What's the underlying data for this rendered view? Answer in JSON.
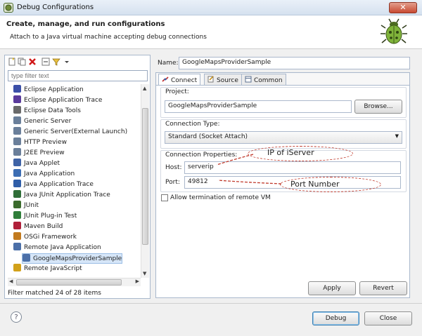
{
  "window": {
    "title": "Debug Configurations",
    "close_glyph": "✕"
  },
  "header": {
    "title": "Create, manage, and run configurations",
    "subtitle": "Attach to a Java virtual machine accepting debug connections"
  },
  "left": {
    "filter_placeholder": "type filter text",
    "filter_status": "Filter matched 24 of 28 items",
    "tree": [
      {
        "label": "Eclipse Application",
        "icon": "eclipse-app-icon",
        "color": "#3b4fa8",
        "indent": 0
      },
      {
        "label": "Eclipse Application Trace",
        "icon": "eclipse-trace-icon",
        "color": "#5a3a9c",
        "indent": 0
      },
      {
        "label": "Eclipse Data Tools",
        "icon": "data-tools-icon",
        "color": "#6a6a6a",
        "indent": 0
      },
      {
        "label": "Generic Server",
        "icon": "server-icon",
        "color": "#6a7f9a",
        "indent": 0
      },
      {
        "label": "Generic Server(External Launch)",
        "icon": "server-icon",
        "color": "#6a7f9a",
        "indent": 0
      },
      {
        "label": "HTTP Preview",
        "icon": "server-icon",
        "color": "#6a7f9a",
        "indent": 0
      },
      {
        "label": "J2EE Preview",
        "icon": "server-icon",
        "color": "#6a7f9a",
        "indent": 0
      },
      {
        "label": "Java Applet",
        "icon": "applet-icon",
        "color": "#3f63a6",
        "indent": 0
      },
      {
        "label": "Java Application",
        "icon": "java-app-icon",
        "color": "#3c6db3",
        "indent": 0
      },
      {
        "label": "Java Application Trace",
        "icon": "java-trace-icon",
        "color": "#2f5ea8",
        "indent": 0
      },
      {
        "label": "Java JUnit Application Trace",
        "icon": "junit-trace-icon",
        "color": "#2f6e38",
        "indent": 0
      },
      {
        "label": "JUnit",
        "icon": "junit-icon",
        "color": "#3b6b2c",
        "indent": 0
      },
      {
        "label": "JUnit Plug-in Test",
        "icon": "junit-plugin-icon",
        "color": "#2f7e3a",
        "indent": 0
      },
      {
        "label": "Maven Build",
        "icon": "maven-icon",
        "color": "#b0203a",
        "indent": 0
      },
      {
        "label": "OSGi Framework",
        "icon": "osgi-icon",
        "color": "#c27a1e",
        "indent": 0
      },
      {
        "label": "Remote Java Application",
        "icon": "remote-java-icon",
        "color": "#4b6fa8",
        "indent": 0
      },
      {
        "label": "GoogleMapsProviderSample",
        "icon": "remote-config-icon",
        "color": "#4b6fa8",
        "indent": 1,
        "selected": true
      },
      {
        "label": "Remote JavaScript",
        "icon": "remote-js-icon",
        "color": "#d2a11a",
        "indent": 0
      }
    ]
  },
  "right": {
    "name_label": "Name:",
    "name_value": "GoogleMapsProviderSample",
    "tabs": [
      "Connect",
      "Source",
      "Common"
    ],
    "project_label": "Project:",
    "project_value": "GoogleMapsProviderSample",
    "browse_label": "Browse...",
    "conn_type_label": "Connection Type:",
    "conn_type_value": "Standard (Socket Attach)",
    "conn_props_label": "Connection Properties:",
    "host_label": "Host:",
    "host_value": "serverip",
    "port_label": "Port:",
    "port_value": "49812",
    "allow_termination_label": "Allow termination of remote VM",
    "allow_termination_checked": false,
    "apply_label": "Apply",
    "revert_label": "Revert"
  },
  "annotations": {
    "ip": "IP of iServer",
    "port": "Port Number"
  },
  "footer": {
    "help_glyph": "?",
    "debug_label": "Debug",
    "close_label": "Close"
  }
}
